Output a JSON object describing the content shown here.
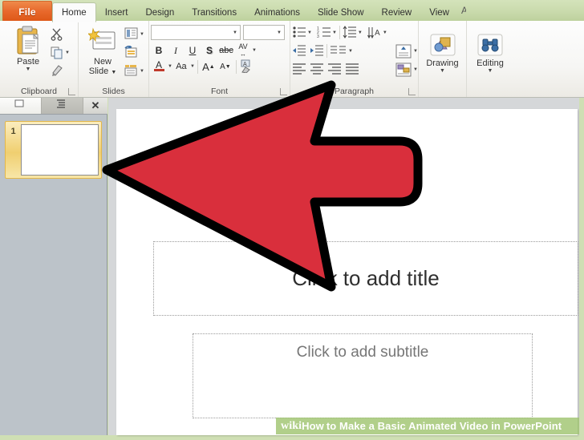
{
  "window": {
    "app": "Microsoft PowerPoint 2010",
    "theme_accent": "#8fbc4e",
    "file_tab_color": "#e8692c"
  },
  "ribbon": {
    "file_tab": "File",
    "tabs": [
      {
        "label": "Home",
        "active": true
      },
      {
        "label": "Insert",
        "active": false
      },
      {
        "label": "Design",
        "active": false
      },
      {
        "label": "Transitions",
        "active": false
      },
      {
        "label": "Animations",
        "active": false
      },
      {
        "label": "Slide Show",
        "active": false
      },
      {
        "label": "Review",
        "active": false
      },
      {
        "label": "View",
        "active": false
      }
    ],
    "overflow_tab": "A",
    "groups": {
      "clipboard": {
        "label": "Clipboard",
        "paste": "Paste",
        "cut_icon": "scissors-icon",
        "copy_icon": "copy-icon",
        "format_painter_icon": "paintbrush-icon"
      },
      "slides": {
        "label": "Slides",
        "new_slide_line1": "New",
        "new_slide_line2": "Slide",
        "layout_icon": "layout-icon",
        "reset_icon": "reset-icon",
        "section_icon": "section-icon"
      },
      "font": {
        "label": "Font",
        "font_name_value": "",
        "font_size_value": "",
        "bold": "B",
        "italic": "I",
        "underline": "U",
        "shadow": "S",
        "strikethrough": "abc",
        "spacing": "AV",
        "font_color": "A",
        "change_case": "Aa",
        "grow_font": "A",
        "shrink_font": "A",
        "clear_formatting_icon": "clear-format-icon"
      },
      "paragraph": {
        "label": "Paragraph",
        "bullets_icon": "bullet-list-icon",
        "numbering_icon": "numbered-list-icon",
        "line_spacing_icon": "line-spacing-icon",
        "text_direction_icon": "text-direction-icon",
        "decrease_indent_icon": "decrease-indent-icon",
        "increase_indent_icon": "increase-indent-icon",
        "columns_icon": "columns-icon",
        "align_text_icon": "align-text-icon",
        "align_left_icon": "align-left-icon",
        "align_center_icon": "align-center-icon",
        "align_right_icon": "align-right-icon",
        "justify_icon": "justify-icon",
        "smartart_icon": "smartart-icon"
      },
      "drawing": {
        "label": "Drawing",
        "icon": "shapes-icon"
      },
      "editing": {
        "label": "Editing",
        "icon": "binoculars-icon"
      }
    }
  },
  "slide_panel": {
    "tab_slides": "Slides",
    "tab_outline": "Outline",
    "close_label": "✕",
    "thumbnails": [
      {
        "number": "1",
        "selected": true
      }
    ]
  },
  "slide": {
    "title_placeholder": "Click to add title",
    "subtitle_placeholder": "Click to add subtitle"
  },
  "annotation": {
    "arrow": {
      "name": "red-arrow-pointer",
      "fill": "#d92f3c",
      "stroke": "#000000",
      "direction": "left"
    }
  },
  "watermark": {
    "wiki": "wiki",
    "how": "How",
    "rest": "to Make a Basic Animated Video in PowerPoint",
    "background": "#a0c470"
  }
}
